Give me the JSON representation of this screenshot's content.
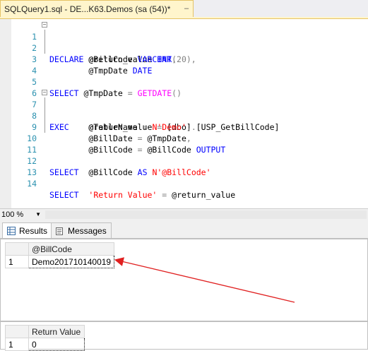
{
  "tab": {
    "title": "SQLQuery1.sql - DE...K63.Demos (sa (54))*",
    "pin_glyph": "–"
  },
  "editor": {
    "line_numbers": [
      "1",
      "2",
      "3",
      "4",
      "5",
      "6",
      "7",
      "8",
      "9",
      "10",
      "11",
      "12",
      "13",
      "14"
    ],
    "lines": {
      "l1": {
        "kw1": "DECLARE",
        "t1": " @return_value ",
        "kw2": "INT",
        "p1": ","
      },
      "l2": {
        "t1": "        @BillCode ",
        "kw1": "VARCHAR",
        "p1": "(20),",
        "t2": ""
      },
      "l3": {
        "t1": "        @TmpDate ",
        "kw1": "DATE"
      },
      "l5": {
        "kw1": "SELECT",
        "t1": " @TmpDate ",
        "p1": "=",
        "t2": " ",
        "fn1": "GETDATE",
        "p2": "()"
      },
      "l7": {
        "kw1": "EXEC",
        "t1": "    @return_value ",
        "p1": "=",
        "t2": " [dbo]",
        "p2": ".",
        "t3": "[USP_GetBillCode]"
      },
      "l8": {
        "t1": "        @TableName ",
        "p1": "=",
        "t2": " ",
        "str1": "N'Demo'",
        "p2": ","
      },
      "l9": {
        "t1": "        @BillDate ",
        "p1": "=",
        "t2": " @TmpDate",
        "p2": ","
      },
      "l10": {
        "t1": "        @BillCode ",
        "p1": "=",
        "t2": " @BillCode ",
        "kw1": "OUTPUT"
      },
      "l12": {
        "kw1": "SELECT",
        "t1": "  @BillCode ",
        "kw2": "AS",
        "t2": " ",
        "str1": "N'@BillCode'"
      },
      "l14": {
        "kw1": "SELECT",
        "t1": "  ",
        "str1": "'Return Value'",
        "t2": " ",
        "p1": "=",
        "t3": " @return_value"
      }
    }
  },
  "zoom": {
    "value": "100 %"
  },
  "results_tabs": {
    "results": "Results",
    "messages": "Messages"
  },
  "grid1": {
    "column": "@BillCode",
    "row_number": "1",
    "value": "Demo201710140019"
  },
  "grid2": {
    "column": "Return Value",
    "row_number": "1",
    "value": "0"
  },
  "colors": {
    "arrow": "#e02020",
    "keyword": "#0000ff",
    "string": "#ff0000",
    "function": "#ff00ff",
    "line_number": "#2b91af",
    "tab_bg": "#fff5cc"
  }
}
